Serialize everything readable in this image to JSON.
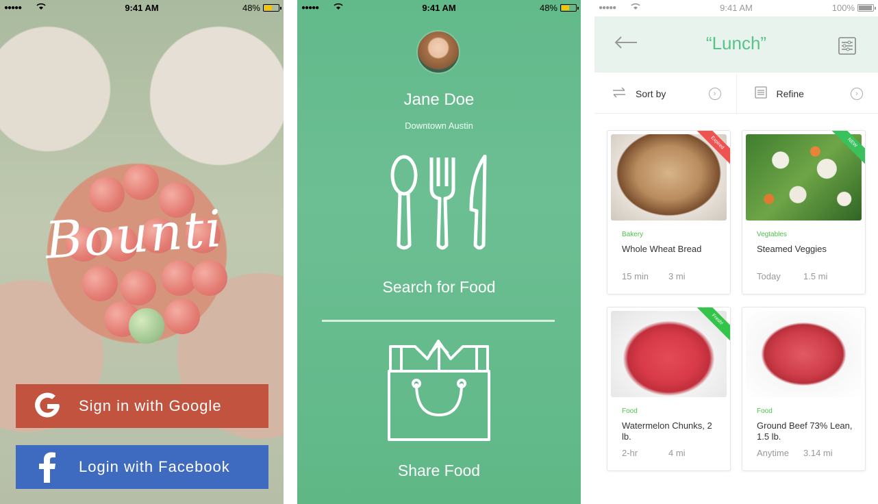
{
  "status": {
    "time": "9:41 AM",
    "battery_left": "48%",
    "battery_right": "100%"
  },
  "login": {
    "brand": "Bounti",
    "google_label": "Sign in with Google",
    "facebook_label": "Login with Facebook"
  },
  "profile": {
    "name": "Jane Doe",
    "location": "Downtown Austin",
    "search_label": "Search for Food",
    "share_label": "Share Food"
  },
  "listing": {
    "title": "“Lunch”",
    "sort_label": "Sort by",
    "refine_label": "Refine",
    "cards": [
      {
        "category": "Bakery",
        "name": "Whole Wheat Bread",
        "meta1": "15 min",
        "meta2": "3 mi",
        "badge": "Expired",
        "badge_color": "#ef5350"
      },
      {
        "category": "Vegtables",
        "name": "Steamed Veggies",
        "meta1": "Today",
        "meta2": "1.5 mi",
        "badge": "NEW",
        "badge_color": "#39c15b"
      },
      {
        "category": "Food",
        "name": "Watermelon Chunks, 2 lb.",
        "meta1": "2-hr",
        "meta2": "4 mi",
        "badge": "Fresh!",
        "badge_color": "#34c44a"
      },
      {
        "category": "Food",
        "name": "Ground Beef 73% Lean, 1.5 lb.",
        "meta1": "Anytime",
        "meta2": "3.14 mi"
      }
    ]
  },
  "icons": [
    "google-icon",
    "facebook-icon",
    "spoon-icon",
    "fork-icon",
    "knife-icon",
    "shopping-bag-icon",
    "back-arrow-icon",
    "filter-icon",
    "sort-icon",
    "refine-icon",
    "chevron-right-icon"
  ]
}
